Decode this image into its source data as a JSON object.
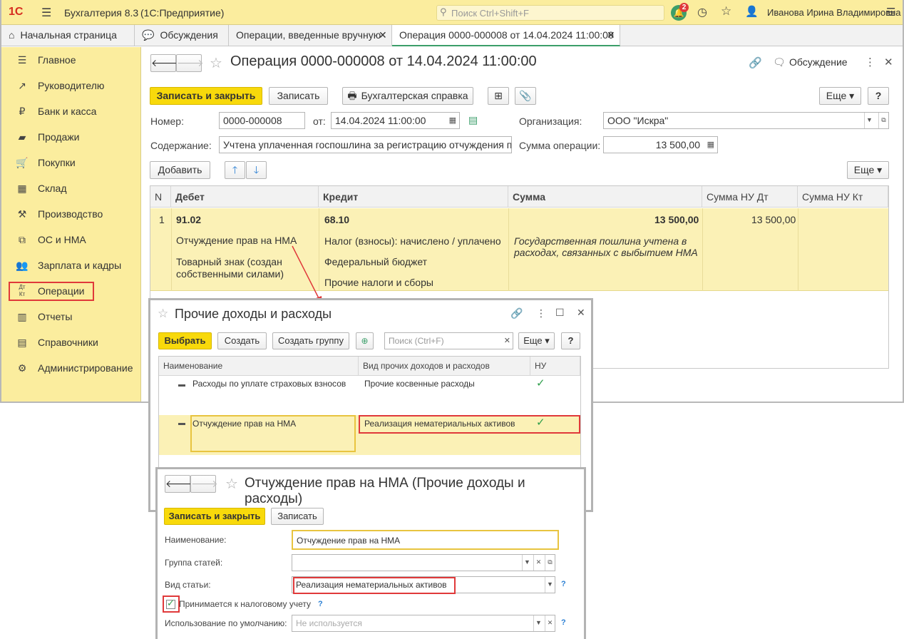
{
  "topbar": {
    "logo": "1С",
    "app_title": "Бухгалтерия 8.3",
    "app_subtitle": "(1С:Предприятие)",
    "search_placeholder": "Поиск Ctrl+Shift+F",
    "notifications_count": "2",
    "user": "Иванова Ирина Владимировна"
  },
  "tabs": [
    {
      "label": "Начальная страница"
    },
    {
      "label": "Обсуждения"
    },
    {
      "label": "Операции, введенные вручную"
    },
    {
      "label": "Операция 0000-000008 от 14.04.2024 11:00:00"
    }
  ],
  "sidebar": {
    "items": [
      {
        "label": "Главное",
        "icon": "menu-icon"
      },
      {
        "label": "Руководителю",
        "icon": "trend-icon"
      },
      {
        "label": "Банк и касса",
        "icon": "coin-icon"
      },
      {
        "label": "Продажи",
        "icon": "bag-icon"
      },
      {
        "label": "Покупки",
        "icon": "cart-icon"
      },
      {
        "label": "Склад",
        "icon": "grid-icon"
      },
      {
        "label": "Производство",
        "icon": "factory-icon"
      },
      {
        "label": "ОС и НМА",
        "icon": "layers-icon"
      },
      {
        "label": "Зарплата и кадры",
        "icon": "people-icon"
      },
      {
        "label": "Операции",
        "icon": "dt-kt-icon"
      },
      {
        "label": "Отчеты",
        "icon": "bar-chart-icon"
      },
      {
        "label": "Справочники",
        "icon": "books-icon"
      },
      {
        "label": "Администрирование",
        "icon": "gear-icon"
      }
    ]
  },
  "doc": {
    "title": "Операция 0000-000008 от 14.04.2024 11:00:00",
    "discussion": "Обсуждение",
    "btn_save_close": "Записать и закрыть",
    "btn_save": "Записать",
    "btn_report": "Бухгалтерская справка",
    "btn_more": "Еще",
    "btn_help": "?",
    "number_label": "Номер:",
    "number_value": "0000-000008",
    "from_label": "от:",
    "date_value": "14.04.2024 11:00:00",
    "org_label": "Организация:",
    "org_value": "ООО \"Искра\"",
    "content_label": "Содержание:",
    "content_value": "Учтена уплаченная госпошлина за регистрацию отчуждения прав",
    "sum_label": "Сумма операции:",
    "sum_value": "13 500,00",
    "btn_add": "Добавить",
    "btn_more2": "Еще"
  },
  "grid": {
    "headers": [
      "N",
      "Дебет",
      "Кредит",
      "Сумма",
      "Сумма НУ Дт",
      "Сумма НУ Кт"
    ],
    "row": {
      "n": "1",
      "debit_account": "91.02",
      "debit_sub1": "Отчуждение прав на НМА",
      "debit_sub2_line1": "Товарный знак (создан",
      "debit_sub2_line2": "собственными силами)",
      "credit_account": "68.10",
      "credit_sub1": "Налог (взносы): начислено / уплачено",
      "credit_sub2": "Федеральный бюджет",
      "credit_sub3": "Прочие налоги и сборы",
      "amount": "13 500,00",
      "comment_line1": "Государственная пошлина учтена в",
      "comment_line2": "расходах, связанных с выбытием НМА",
      "nu_dt": "13 500,00"
    }
  },
  "popup1": {
    "title": "Прочие доходы и расходы",
    "btn_select": "Выбрать",
    "btn_create": "Создать",
    "btn_create_group": "Создать группу",
    "search_placeholder": "Поиск (Ctrl+F)",
    "btn_more": "Еще",
    "btn_help": "?",
    "headers": [
      "Наименование",
      "Вид прочих доходов и расходов",
      "НУ"
    ],
    "rows": [
      {
        "name": "Расходы по уплате страховых взносов",
        "kind": "Прочие косвенные расходы",
        "nu": "✓"
      },
      {
        "name": "Отчуждение прав на НМА",
        "kind": "Реализация нематериальных активов",
        "nu": "✓"
      }
    ]
  },
  "popup2": {
    "title": "Отчуждение прав на НМА (Прочие доходы и расходы)",
    "btn_save_close": "Записать и закрыть",
    "btn_save": "Записать",
    "name_label": "Наименование:",
    "name_value": "Отчуждение прав на НМА",
    "group_label": "Группа статей:",
    "group_value": "",
    "kind_label": "Вид статьи:",
    "kind_value": "Реализация нематериальных активов",
    "tax_label": "Принимается к налоговому учету",
    "default_label": "Использование по умолчанию:",
    "default_placeholder": "Не используется",
    "help": "?"
  },
  "colors": {
    "accent_yellow": "#f8d90b",
    "panel_yellow": "#fbed9e",
    "selection_yellow": "#fbf1b6",
    "highlight_red": "#e0393a",
    "check_green": "#2e9e4a"
  }
}
